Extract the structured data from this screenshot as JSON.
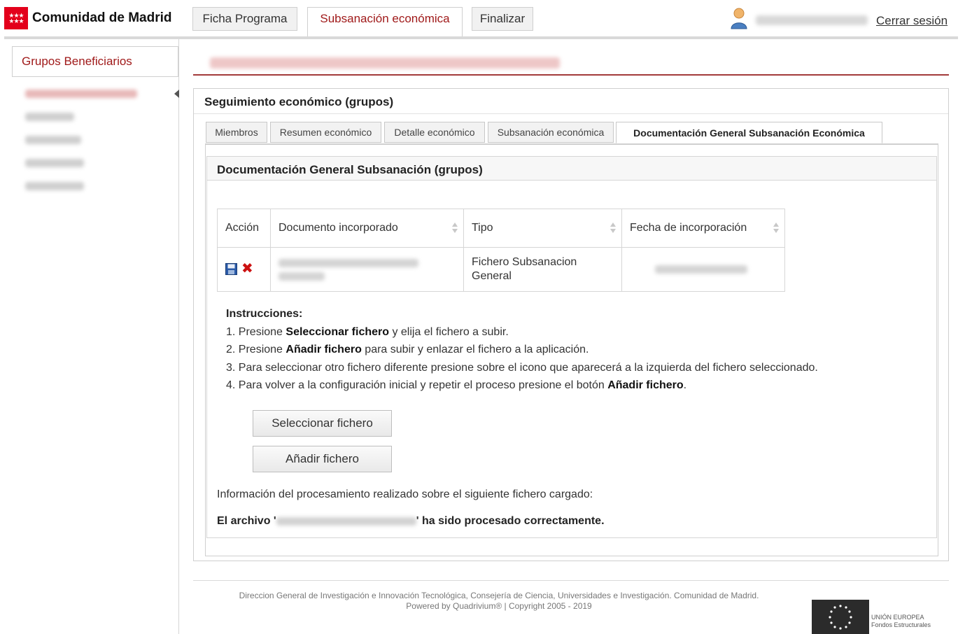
{
  "header": {
    "logo_text": "Comunidad de Madrid",
    "tabs": [
      {
        "label": "Ficha Programa",
        "active": false
      },
      {
        "label": "Subsanación económica",
        "active": true
      },
      {
        "label": "Finalizar",
        "active": false
      }
    ],
    "logout_label": "Cerrar sesión"
  },
  "sidebar": {
    "title": "Grupos Beneficiarios"
  },
  "panel": {
    "title": "Seguimiento económico (grupos)",
    "tabs": [
      {
        "label": "Miembros",
        "active": false
      },
      {
        "label": "Resumen económico",
        "active": false
      },
      {
        "label": "Detalle económico",
        "active": false
      },
      {
        "label": "Subsanación económica",
        "active": false
      },
      {
        "label": "Documentación General Subsanación Económica",
        "active": true
      }
    ]
  },
  "section": {
    "title": "Documentación General Subsanación (grupos)",
    "table": {
      "columns": [
        "Acción",
        "Documento incorporado",
        "Tipo",
        "Fecha de incorporación"
      ],
      "rows": [
        {
          "tipo": "Fichero Subsanacion General"
        }
      ]
    },
    "instructions": {
      "heading": "Instrucciones:",
      "step1_a": "1. Presione ",
      "step1_b": "Seleccionar fichero",
      "step1_c": " y elija el fichero a subir.",
      "step2_a": "2. Presione ",
      "step2_b": "Añadir fichero",
      "step2_c": " para subir y enlazar el fichero a la aplicación.",
      "step3": "3. Para seleccionar otro fichero diferente presione sobre el icono que aparecerá a la izquierda del fichero seleccionado.",
      "step4_a": "4. Para volver a la configuración inicial y repetir el proceso presione el botón ",
      "step4_b": "Añadir fichero",
      "step4_c": "."
    },
    "select_button": "Seleccionar fichero",
    "add_button": "Añadir fichero",
    "info_text": "Información del procesamiento realizado sobre el siguiente fichero cargado:",
    "result_prefix": "El archivo '",
    "result_suffix": "' ha sido procesado correctamente."
  },
  "footer": {
    "line1": "Direccion General de Investigación e Innovación Tecnológica, Consejería de Ciencia, Universidades e Investigación. Comunidad de Madrid.",
    "line2": "Powered by Quadrivium® | Copyright 2005 - 2019",
    "eu_line1": "UNIÓN EUROPEA",
    "eu_line2": "Fondos Estructurales"
  },
  "colors": {
    "brand_red": "#e3001b",
    "active_tab_text": "#a01a1a",
    "delete_icon": "#cc1111"
  }
}
